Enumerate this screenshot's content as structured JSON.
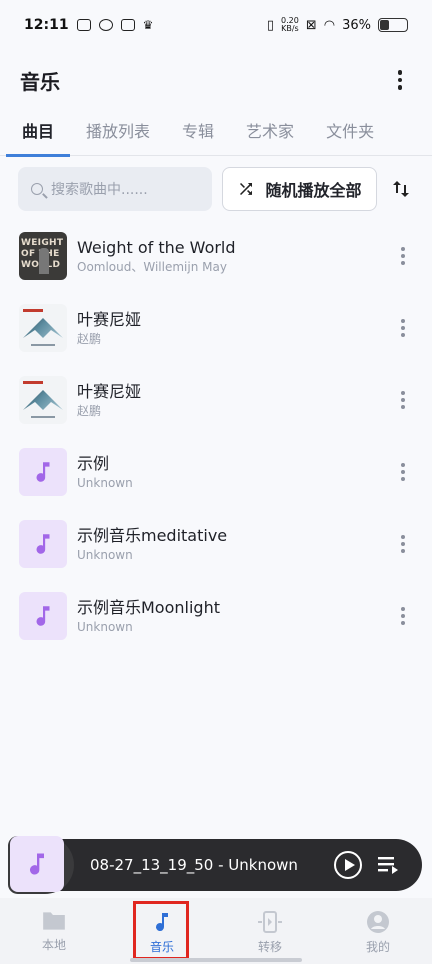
{
  "status_bar": {
    "time": "12:11",
    "net_speed_value": "0.20",
    "net_speed_unit": "KB/s",
    "battery": "36%"
  },
  "app_bar": {
    "title": "音乐",
    "more_icon": "more-vert-icon"
  },
  "tabs": [
    {
      "label": "曲目",
      "active": true
    },
    {
      "label": "播放列表",
      "active": false
    },
    {
      "label": "专辑",
      "active": false
    },
    {
      "label": "艺术家",
      "active": false
    },
    {
      "label": "文件夹",
      "active": false
    }
  ],
  "controls": {
    "search_placeholder": "搜索歌曲中......",
    "shuffle_label": "随机播放全部",
    "sort_icon": "sort-arrows-icon"
  },
  "songs": [
    {
      "title": "Weight of the World",
      "artist": "Oomloud、Willemijn May",
      "cover_text": "WEIGHT OF THE WORLD"
    },
    {
      "title": "叶赛尼娅",
      "artist": "赵鹏"
    },
    {
      "title": "叶赛尼娅",
      "artist": "赵鹏"
    },
    {
      "title": "示例",
      "artist": "Unknown"
    },
    {
      "title": "示例音乐meditative",
      "artist": "Unknown"
    },
    {
      "title": "示例音乐Moonlight",
      "artist": "Unknown"
    }
  ],
  "now_playing": {
    "title": "08-27_13_19_50 - Unknown"
  },
  "bottom_nav": [
    {
      "label": "本地",
      "icon": "folder-icon",
      "active": false
    },
    {
      "label": "音乐",
      "icon": "music-note-icon",
      "active": true
    },
    {
      "label": "转移",
      "icon": "transfer-icon",
      "active": false
    },
    {
      "label": "我的",
      "icon": "account-icon",
      "active": false
    }
  ],
  "colors": {
    "accent": "#2f6fd6",
    "tab_indicator": "#3f7fd9",
    "note_tile": "#ece2fb",
    "note_glyph": "#a267e8",
    "player_bg": "#2b2b2e",
    "highlight_frame": "#e0261f"
  }
}
